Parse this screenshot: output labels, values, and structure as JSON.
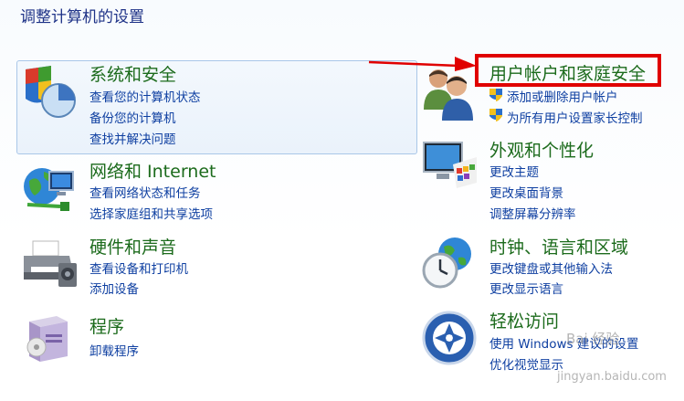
{
  "page_title": "调整计算机的设置",
  "categories": [
    {
      "title": "系统和安全",
      "icon": "shield-chart-icon",
      "links": [
        "查看您的计算机状态",
        "备份您的计算机",
        "查找并解决问题"
      ]
    },
    {
      "title": "网络和 Internet",
      "icon": "globe-network-icon",
      "links": [
        "查看网络状态和任务",
        "选择家庭组和共享选项"
      ]
    },
    {
      "title": "硬件和声音",
      "icon": "printer-icon",
      "links": [
        "查看设备和打印机",
        "添加设备"
      ]
    },
    {
      "title": "程序",
      "icon": "programs-box-icon",
      "links": [
        "卸载程序"
      ]
    },
    {
      "title": "用户帐户和家庭安全",
      "icon": "users-icon",
      "links": [
        "添加或删除用户帐户",
        "为所有用户设置家长控制"
      ]
    },
    {
      "title": "外观和个性化",
      "icon": "monitor-palette-icon",
      "links": [
        "更改主题",
        "更改桌面背景",
        "调整屏幕分辨率"
      ]
    },
    {
      "title": "时钟、语言和区域",
      "icon": "clock-globe-icon",
      "links": [
        "更改键盘或其他输入法",
        "更改显示语言"
      ]
    },
    {
      "title": "轻松访问",
      "icon": "accessibility-icon",
      "links": [
        "使用 Windows 建议的设置",
        "优化视觉显示"
      ]
    }
  ],
  "watermark": {
    "brand": "Bai 经验",
    "url": "jingyan.baidu.com"
  },
  "colors": {
    "highlight": "#e00000",
    "title_green": "#1c6b1c",
    "link_blue": "#0e3fa1"
  }
}
